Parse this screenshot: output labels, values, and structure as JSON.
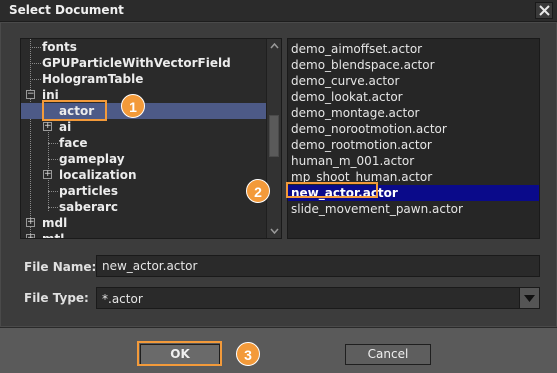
{
  "window": {
    "title": "Select Document",
    "close_label": "✕"
  },
  "tree": {
    "items": [
      {
        "label": "fonts"
      },
      {
        "label": "GPUParticleWithVectorField"
      },
      {
        "label": "HologramTable"
      },
      {
        "label": "ini",
        "expander": "−"
      },
      {
        "label": "actor",
        "selected": true
      },
      {
        "label": "ai",
        "expander": "+"
      },
      {
        "label": "face"
      },
      {
        "label": "gameplay"
      },
      {
        "label": "localization",
        "expander": "+"
      },
      {
        "label": "particles"
      },
      {
        "label": "saberarc"
      },
      {
        "label": "mdl",
        "expander": "+"
      },
      {
        "label": "mtl",
        "expander": "+"
      }
    ],
    "scroll_up": "▲",
    "scroll_down": "▼"
  },
  "files": {
    "items": [
      {
        "label": "demo_aimoffset.actor"
      },
      {
        "label": "demo_blendspace.actor"
      },
      {
        "label": "demo_curve.actor"
      },
      {
        "label": "demo_lookat.actor"
      },
      {
        "label": "demo_montage.actor"
      },
      {
        "label": "demo_norootmotion.actor"
      },
      {
        "label": "demo_rootmotion.actor"
      },
      {
        "label": "human_m_001.actor"
      },
      {
        "label": "mp_shoot_human.actor"
      },
      {
        "label": "new_actor.actor",
        "selected": true
      },
      {
        "label": "slide_movement_pawn.actor"
      }
    ]
  },
  "form": {
    "file_name_label": "File Name:",
    "file_name_value": "new_actor.actor",
    "file_type_label": "File Type:",
    "file_type_value": "*.actor",
    "dropdown_arrow": "▼"
  },
  "buttons": {
    "ok": "OK",
    "cancel": "Cancel"
  },
  "callouts": [
    "1",
    "2",
    "3"
  ],
  "colors": {
    "accent": "#f39a3a",
    "tree_selection": "#4d5a87",
    "list_selection": "#0a0a8a"
  }
}
